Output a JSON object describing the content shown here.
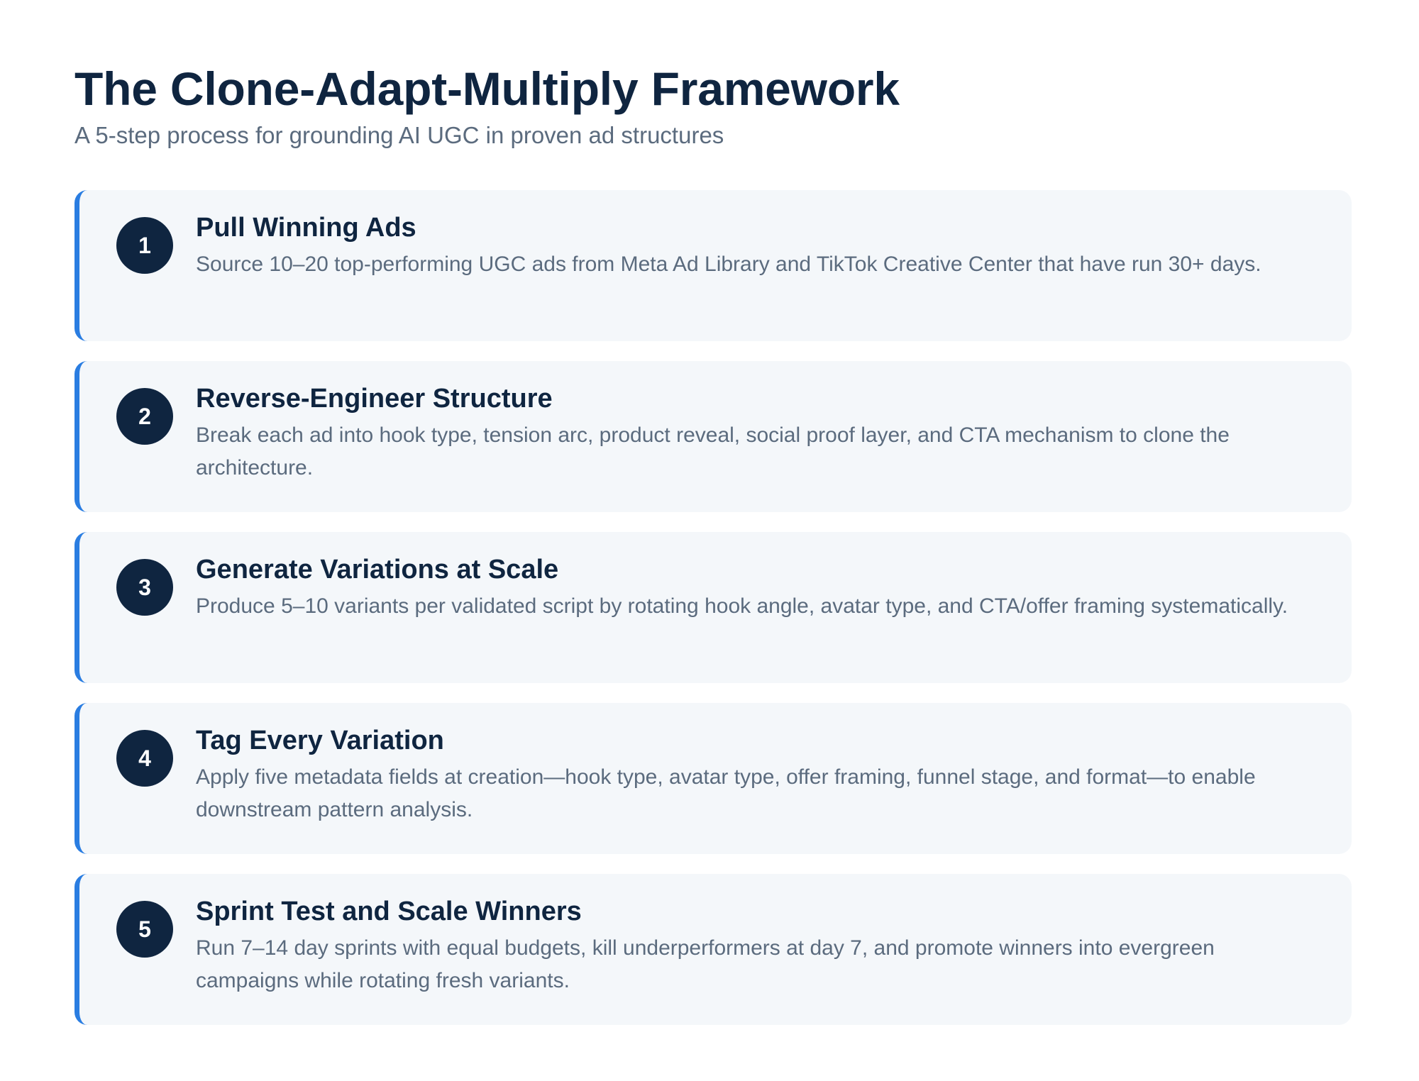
{
  "header": {
    "title": "The Clone-Adapt-Multiply Framework",
    "subtitle": "A 5-step process for grounding AI UGC in proven ad structures"
  },
  "steps": [
    {
      "number": "1",
      "title": "Pull Winning Ads",
      "description": "Source 10–20 top-performing UGC ads from Meta Ad Library and TikTok Creative Center that have run 30+ days."
    },
    {
      "number": "2",
      "title": "Reverse-Engineer Structure",
      "description": "Break each ad into hook type, tension arc, product reveal, social proof layer, and CTA mechanism to clone the architecture."
    },
    {
      "number": "3",
      "title": "Generate Variations at Scale",
      "description": "Produce 5–10 variants per validated script by rotating hook angle, avatar type, and CTA/offer framing systematically."
    },
    {
      "number": "4",
      "title": "Tag Every Variation",
      "description": "Apply five metadata fields at creation—hook type, avatar type, offer framing, funnel stage, and format—to enable downstream pattern analysis."
    },
    {
      "number": "5",
      "title": "Sprint Test and Scale Winners",
      "description": "Run 7–14 day sprints with equal budgets, kill underperformers at day 7, and promote winners into evergreen campaigns while rotating fresh variants."
    }
  ],
  "colors": {
    "accent": "#2a7de1",
    "heading": "#0f2540",
    "body_text": "#5b6b7e",
    "card_background": "#f4f7fa"
  }
}
